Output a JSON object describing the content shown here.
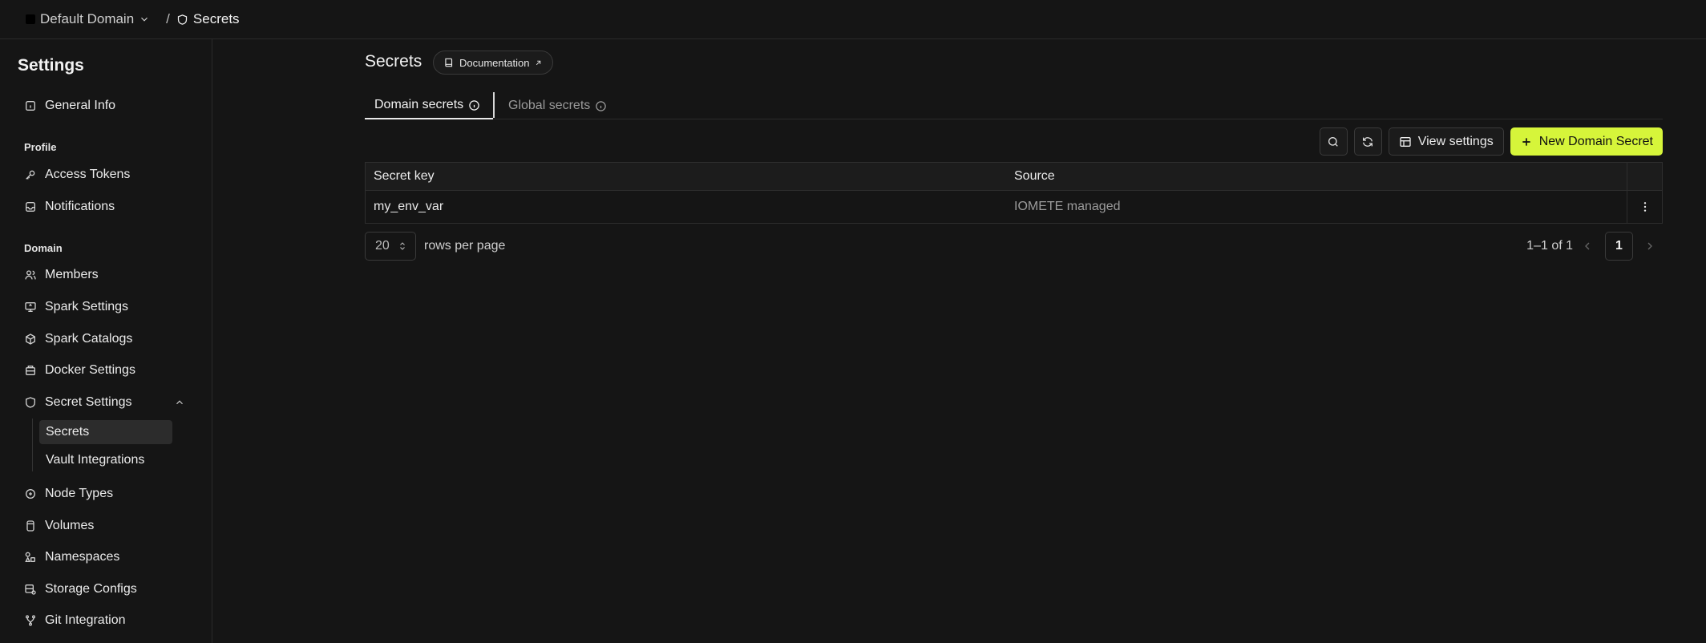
{
  "topbar": {
    "domain_name": "Default Domain",
    "separator": "/",
    "current_page": "Secrets"
  },
  "sidebar": {
    "title": "Settings",
    "general_info": "General Info",
    "profile_label": "Profile",
    "access_tokens": "Access Tokens",
    "notifications": "Notifications",
    "domain_label": "Domain",
    "members": "Members",
    "spark_settings": "Spark Settings",
    "spark_catalogs": "Spark Catalogs",
    "docker_settings": "Docker Settings",
    "secret_settings": "Secret Settings",
    "secrets": "Secrets",
    "vault_integrations": "Vault Integrations",
    "node_types": "Node Types",
    "volumes": "Volumes",
    "namespaces": "Namespaces",
    "storage_configs": "Storage Configs",
    "git_integration": "Git Integration"
  },
  "main": {
    "title": "Secrets",
    "documentation": "Documentation",
    "tabs": [
      {
        "label": "Domain secrets",
        "active": true
      },
      {
        "label": "Global secrets",
        "active": false
      }
    ],
    "toolbar": {
      "view_settings": "View settings",
      "new_secret": "New Domain Secret"
    },
    "table": {
      "columns": [
        "Secret key",
        "Source"
      ],
      "rows": [
        {
          "key": "my_env_var",
          "source": "IOMETE managed"
        }
      ]
    },
    "pagination": {
      "per_page": "20",
      "per_page_label": "rows per page",
      "range": "1–1 of 1",
      "current_page": "1"
    }
  },
  "colors": {
    "background": "#151515",
    "accent": "#d6f53a",
    "border": "#2e2e2e"
  }
}
